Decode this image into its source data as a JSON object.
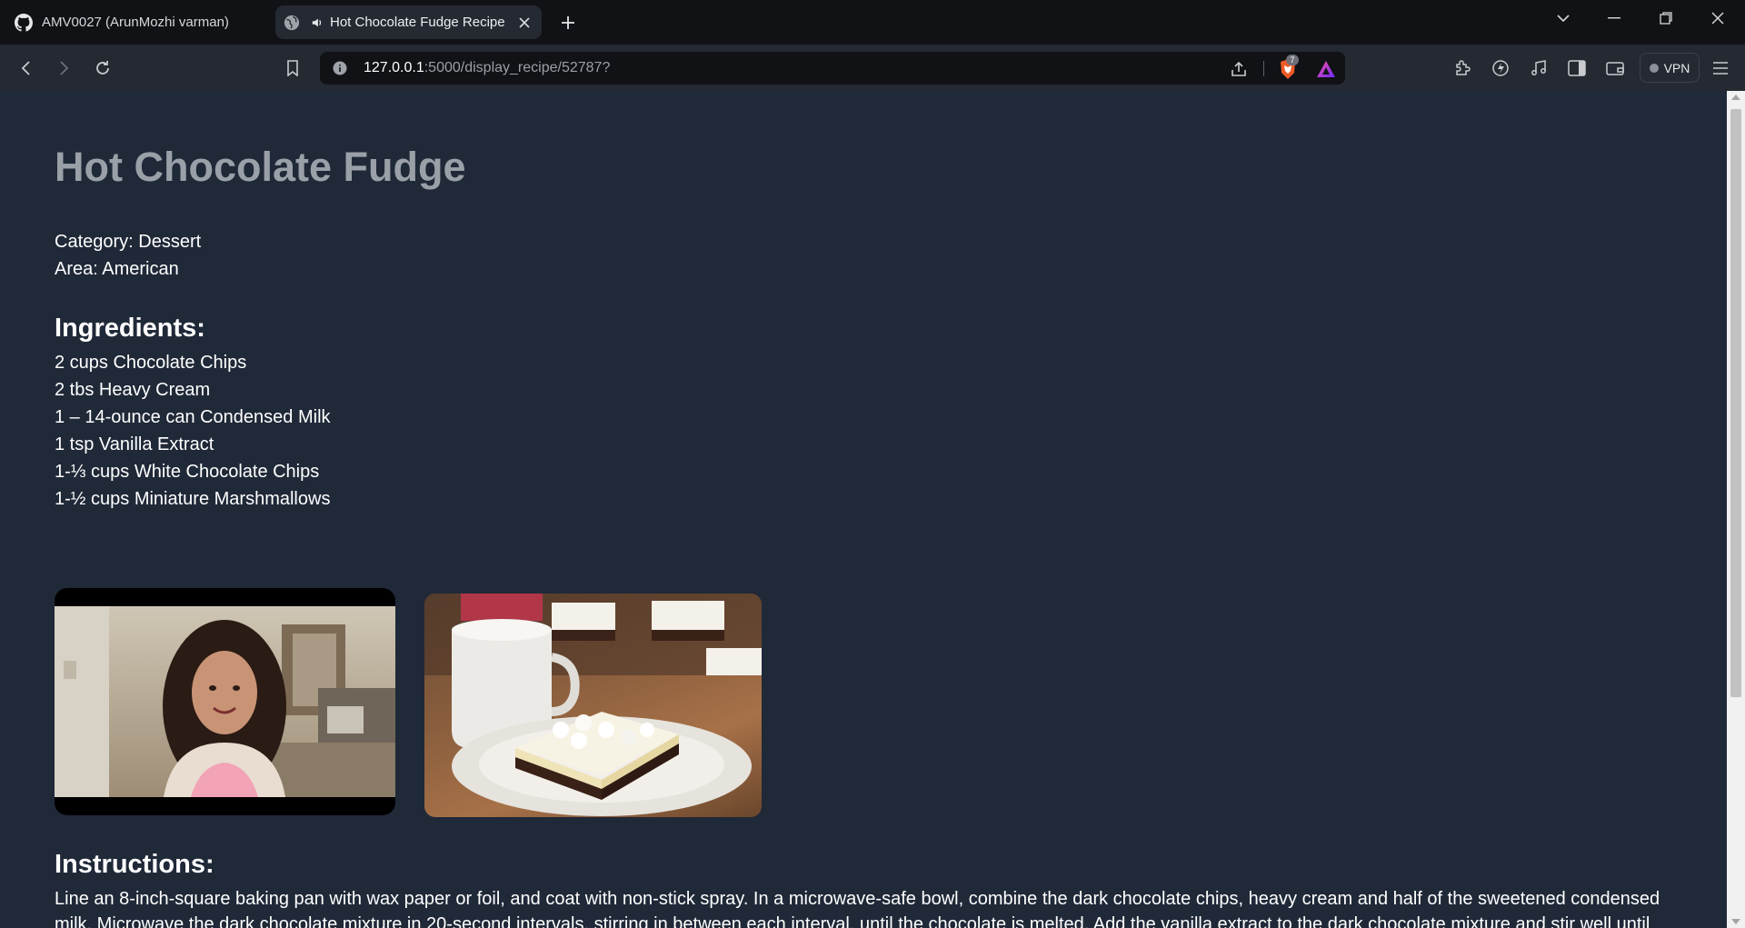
{
  "browser": {
    "tabs": [
      {
        "label": "AMV0027 (ArunMozhi varman)",
        "icon": "github-icon",
        "active": false
      },
      {
        "label": "Hot Chocolate Fudge Recipe",
        "icon": "globe-icon",
        "active": true
      }
    ],
    "address": {
      "host": "127.0.0.1",
      "rest": ":5000/display_recipe/52787?"
    },
    "shields_count": "7",
    "vpn_label": "VPN"
  },
  "recipe": {
    "title": "Hot Chocolate Fudge",
    "category": "Category: Dessert",
    "area": "Area: American",
    "ingredients_heading": "Ingredients:",
    "ingredients": [
      "2 cups Chocolate Chips",
      "2 tbs Heavy Cream",
      "1 – 14-ounce can Condensed Milk",
      "1 tsp Vanilla Extract",
      "1-⅓ cups White Chocolate Chips",
      "1-½ cups Miniature Marshmallows"
    ],
    "instructions_heading": "Instructions:",
    "instructions": "Line an 8-inch-square baking pan with wax paper or foil, and coat with non-stick spray. In a microwave-safe bowl, combine the dark chocolate chips, heavy cream and half of the sweetened condensed milk. Microwave the dark chocolate mixture in 20-second intervals, stirring in between each interval, until the chocolate is melted. Add the vanilla extract to the dark chocolate mixture and stir well until"
  },
  "colors": {
    "page_bg": "#202938",
    "title": "#9aa0a8",
    "tabstrip": "#101216",
    "toolbar": "#252932"
  }
}
